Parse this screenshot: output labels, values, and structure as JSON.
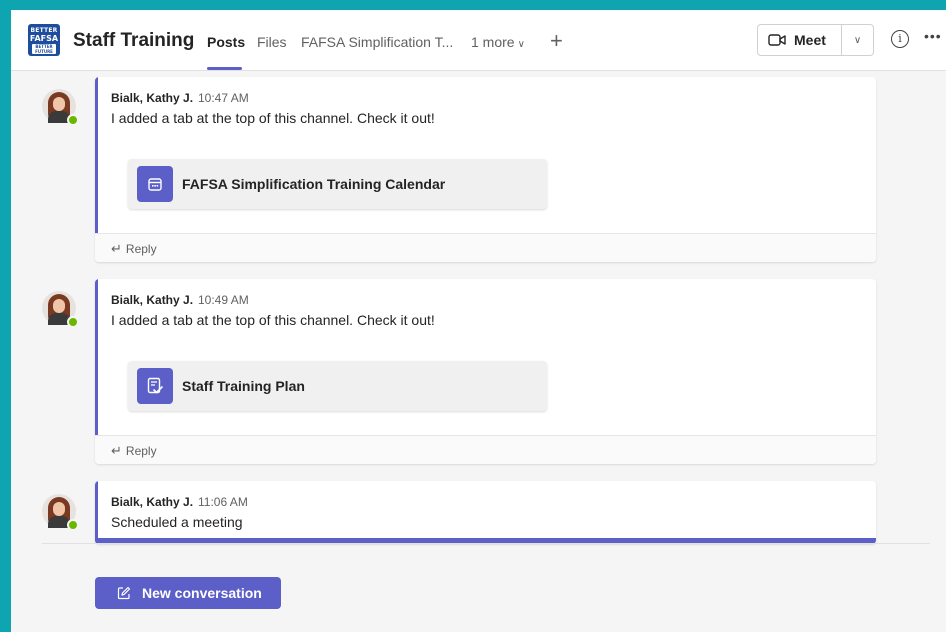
{
  "header": {
    "team_logo_text": [
      "BETTER",
      "FAFSA",
      "BETTER FUTURE"
    ],
    "team_name": "Staff Training",
    "tabs": [
      {
        "label": "Posts",
        "active": true
      },
      {
        "label": "Files",
        "active": false
      },
      {
        "label": "FAFSA Simplification T...",
        "active": false
      }
    ],
    "more_label": "1 more",
    "add_tab_icon": "plus-icon",
    "meet_label": "Meet",
    "meet_icon": "video-camera-icon",
    "info_icon": "info-icon",
    "more_options_icon": "ellipsis-icon"
  },
  "posts": [
    {
      "author": "Bialk, Kathy J.",
      "time": "10:47 AM",
      "message": "I added a tab at the top of this channel. Check it out!",
      "card": {
        "title": "FAFSA Simplification Training Calendar",
        "icon": "calendar-icon"
      },
      "reply_label": "Reply"
    },
    {
      "author": "Bialk, Kathy J.",
      "time": "10:49 AM",
      "message": "I added a tab at the top of this channel. Check it out!",
      "card": {
        "title": "Staff Training Plan",
        "icon": "checklist-icon"
      },
      "reply_label": "Reply"
    },
    {
      "author": "Bialk, Kathy J.",
      "time": "11:06 AM",
      "message": "Scheduled a meeting"
    }
  ],
  "new_conversation_label": "New conversation",
  "colors": {
    "accent": "#5b5fc7",
    "presence": "#6bb700",
    "frame": "#0fa5b0"
  }
}
